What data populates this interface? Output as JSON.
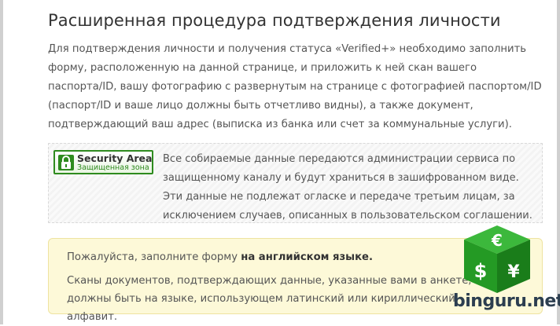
{
  "page": {
    "title": "Расширенная процедура подтверждения личности",
    "intro": "Для подтверждения личности и получения статуса «Verified+» необходимо заполнить форму, расположенную на данной странице, и приложить к ней скан вашего паспорта/ID, вашу фотографию с развернутым на странице с фотографией паспортом/ID (паспорт/ID и ваше лицо должны быть отчетливо видны), а также документ, подтверждающий ваш адрес (выписка из банка или счет за коммунальные услуги)."
  },
  "security": {
    "badge_title": "Security Area",
    "badge_subtitle": "Защищенная зона",
    "text": "Все собираемые данные передаются администрации сервиса по защищенному каналу и будут храниться в зашифрованном виде. Эти данные не подлежат огласке и передаче третьим лицам, за исключением случаев, описанных в пользовательском соглашении.",
    "accent_color": "#2e8b1e"
  },
  "notice": {
    "line1_prefix": "Пожалуйста, заполните форму ",
    "line1_bold": "на английском языке.",
    "line2": "Сканы документов, подтверждающих данные, указанные вами в анкете, должны быть на языке, использующем латинский или кириллический алфавит."
  },
  "watermark": {
    "text": "binguru.net",
    "icon": "currency-cube-icon",
    "colors": [
      "#2fa82f",
      "#1e7a1e"
    ]
  }
}
